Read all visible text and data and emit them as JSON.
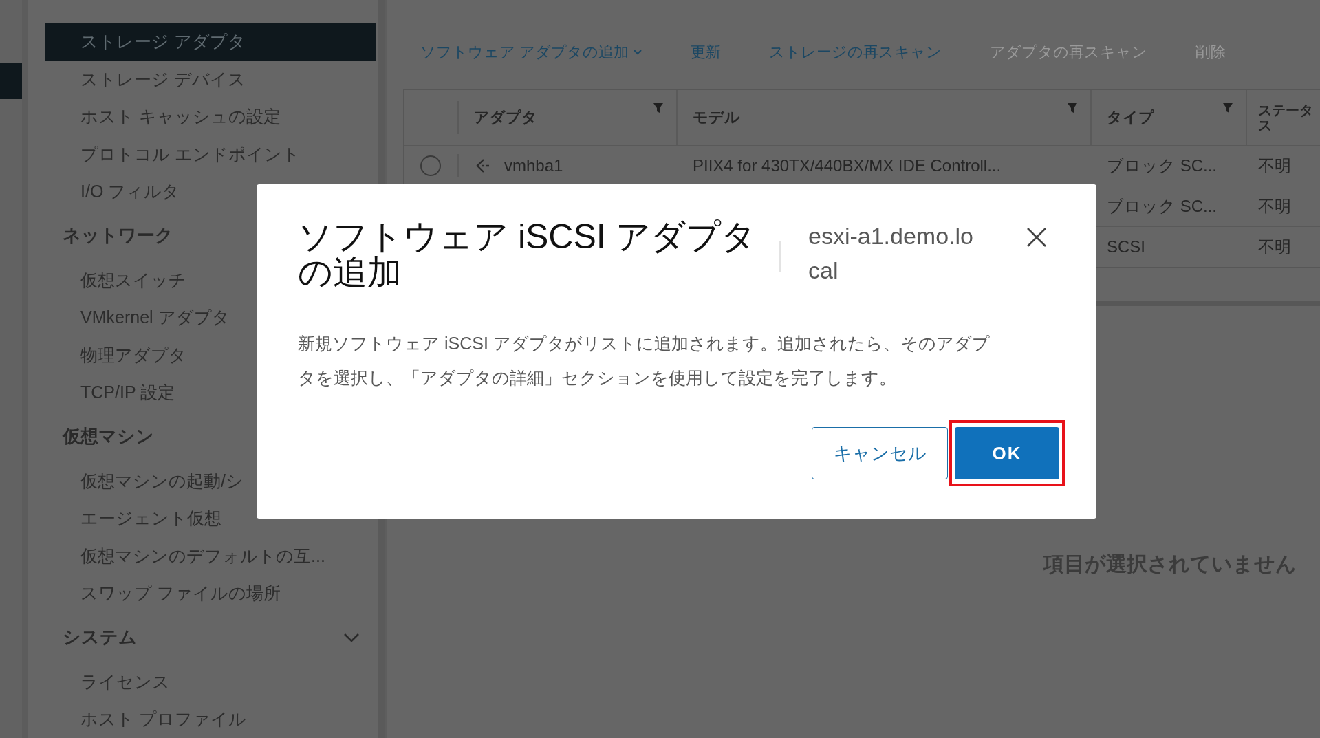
{
  "sidebar": {
    "groups": [
      {
        "items": [
          {
            "label": "ストレージ アダプタ",
            "selected": true
          },
          {
            "label": "ストレージ デバイス",
            "selected": false
          },
          {
            "label": "ホスト キャッシュの設定",
            "selected": false
          },
          {
            "label": "プロトコル エンドポイント",
            "selected": false
          },
          {
            "label": "I/O フィルタ",
            "selected": false
          }
        ]
      },
      {
        "title": "ネットワーク",
        "items": [
          {
            "label": "仮想スイッチ",
            "selected": false
          },
          {
            "label": "VMkernel アダプタ",
            "selected": false
          },
          {
            "label": "物理アダプタ",
            "selected": false
          },
          {
            "label": "TCP/IP 設定",
            "selected": false
          }
        ]
      },
      {
        "title": "仮想マシン",
        "items": [
          {
            "label": "仮想マシンの起動/シ",
            "selected": false
          },
          {
            "label": "エージェント仮想",
            "selected": false
          },
          {
            "label": "仮想マシンのデフォルトの互...",
            "selected": false
          },
          {
            "label": "スワップ ファイルの場所",
            "selected": false
          }
        ]
      },
      {
        "title": "システム",
        "expanded": true,
        "items": [
          {
            "label": "ライセンス",
            "selected": false
          },
          {
            "label": "ホスト プロファイル",
            "selected": false
          }
        ]
      }
    ]
  },
  "toolbar": [
    {
      "label": "ソフトウェア アダプタの追加",
      "kind": "dropdown",
      "disabled": false
    },
    {
      "label": "更新",
      "kind": "action",
      "disabled": false
    },
    {
      "label": "ストレージの再スキャン",
      "kind": "action",
      "disabled": false
    },
    {
      "label": "アダプタの再スキャン",
      "kind": "action",
      "disabled": true
    },
    {
      "label": "削除",
      "kind": "action",
      "disabled": true
    }
  ],
  "table": {
    "columns": [
      {
        "label": "アダプタ",
        "filter": true
      },
      {
        "label": "モデル",
        "filter": true
      },
      {
        "label": "タイプ",
        "filter": true
      },
      {
        "label": "ステータス",
        "filter": false
      }
    ],
    "rows": [
      {
        "selected": false,
        "adapter": "vmhba1",
        "model": "PIIX4 for 430TX/440BX/MX IDE Controll...",
        "type": "ブロック SC...",
        "status": "不明"
      },
      {
        "type": "ブロック SC...",
        "status": "不明"
      },
      {
        "type": "SCSI",
        "status": "不明"
      }
    ]
  },
  "details": {
    "empty_message": "項目が選択されていません"
  },
  "dialog": {
    "title": "ソフトウェア iSCSI アダプタの追加",
    "host": "esxi-a1.demo.local",
    "message": "新規ソフトウェア iSCSI アダプタがリストに追加されます。追加されたら、そのアダプタを選択し、「アダプタの詳細」セクションを使用して設定を完了します。",
    "buttons": [
      {
        "label": "キャンセル",
        "kind": "secondary",
        "highlighted": false
      },
      {
        "label": "OK",
        "kind": "primary",
        "highlighted": true
      }
    ]
  }
}
